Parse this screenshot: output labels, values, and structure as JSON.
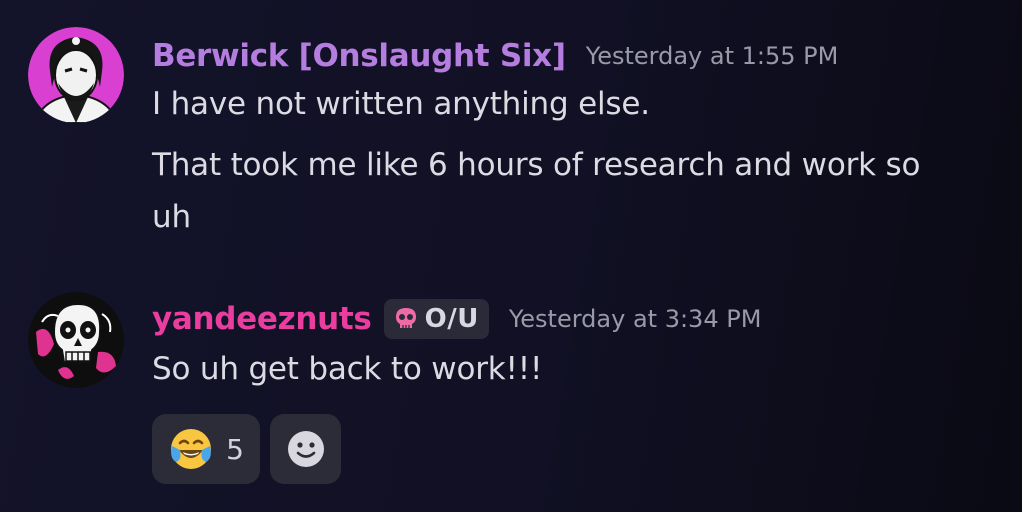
{
  "messages": [
    {
      "author": "Berwick [Onslaught Six]",
      "author_color": "#b57de0",
      "timestamp": "Yesterday at 1:55 PM",
      "lines": [
        "I have not written anything else.",
        "That took me like 6 hours of research and work so",
        "uh"
      ],
      "avatar_icon": "bearded-man-portrait-icon"
    },
    {
      "author": "yandeeznuts",
      "author_color": "#e93d9f",
      "tag": {
        "icon": "pink-skull-icon",
        "label": "O/U"
      },
      "timestamp": "Yesterday at 3:34 PM",
      "lines": [
        "So uh get back to work!!!"
      ],
      "avatar_icon": "skull-portrait-icon",
      "reactions": [
        {
          "emoji": "😂",
          "emoji_name": "face-with-tears-of-joy-icon",
          "count": "5"
        },
        {
          "emoji_name": "add-reaction-smiley-icon"
        }
      ]
    }
  ]
}
